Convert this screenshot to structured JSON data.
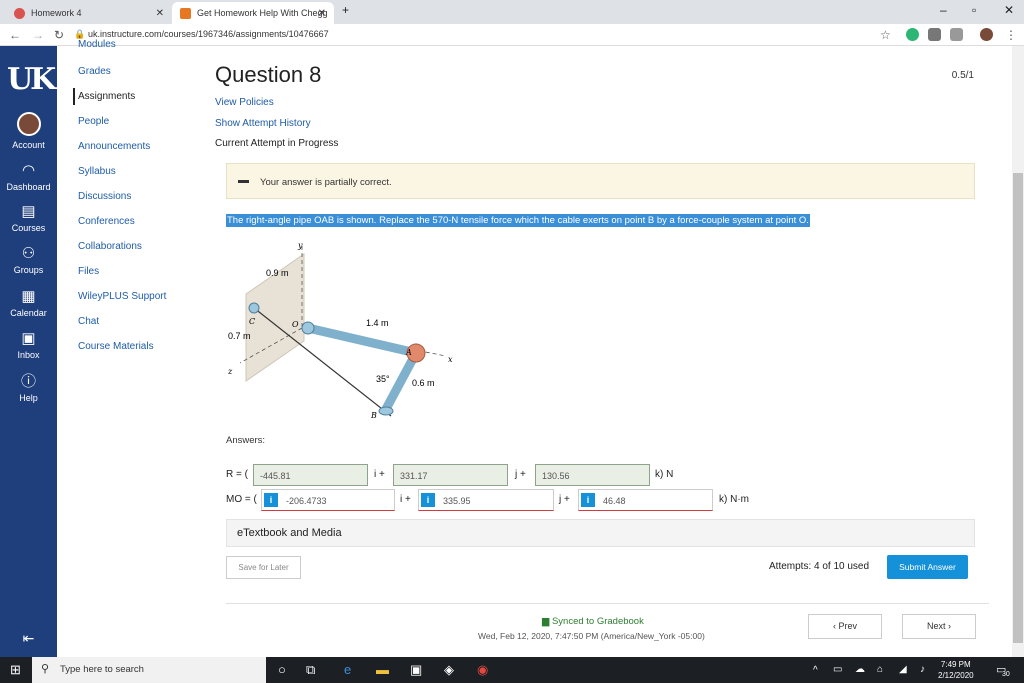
{
  "browser": {
    "tabs": [
      {
        "title": "Homework 4"
      },
      {
        "title": "Get Homework Help With Chegg"
      }
    ],
    "url": "uk.instructure.com/courses/1967346/assignments/10476667",
    "new_tab": "+"
  },
  "global_nav": {
    "logo": "UK",
    "items": [
      {
        "label": "Account",
        "icon": "avatar"
      },
      {
        "label": "Dashboard",
        "icon": "dashboard-icon"
      },
      {
        "label": "Courses",
        "icon": "book-icon"
      },
      {
        "label": "Groups",
        "icon": "groups-icon"
      },
      {
        "label": "Calendar",
        "icon": "calendar-icon"
      },
      {
        "label": "Inbox",
        "icon": "inbox-icon"
      },
      {
        "label": "Help",
        "icon": "help-icon"
      }
    ]
  },
  "course_nav": {
    "items": [
      {
        "label": "Modules"
      },
      {
        "label": "Grades"
      },
      {
        "label": "Assignments"
      },
      {
        "label": "People"
      },
      {
        "label": "Announcements"
      },
      {
        "label": "Syllabus"
      },
      {
        "label": "Discussions"
      },
      {
        "label": "Conferences"
      },
      {
        "label": "Collaborations"
      },
      {
        "label": "Files"
      },
      {
        "label": "WileyPLUS Support"
      },
      {
        "label": "Chat"
      },
      {
        "label": "Course Materials"
      }
    ]
  },
  "question": {
    "title": "Question 8",
    "score": "0.5/1",
    "view_policies": "View Policies",
    "show_history": "Show Attempt History",
    "status": "Current Attempt in Progress",
    "alert": "Your answer is partially correct.",
    "text": "The right-angle pipe OAB is shown. Replace the 570-N tensile force which the cable exerts on point B by a force-couple system at point O.",
    "figure_labels": {
      "y": "y",
      "x": "x",
      "z": "z",
      "c": "C",
      "o": "O",
      "a": "A",
      "b": "B",
      "d1": "0.9 m",
      "d2": "1.4 m",
      "d3": "0.7 m",
      "d4": "0.6 m",
      "angle": "35°"
    }
  },
  "answers": {
    "label": "Answers:",
    "r_label": "R = (",
    "r_values": [
      "-445.81",
      "331.17",
      "130.56"
    ],
    "r_unit": "k) N",
    "m_label": "MO = (",
    "m_values": [
      "-206.4733",
      "335.95",
      "46.48"
    ],
    "m_unit": "k) N·m",
    "i_sep": "i +",
    "j_sep": "j +",
    "info": "i"
  },
  "etextbook": "eTextbook and Media",
  "save_later": "Save for Later",
  "attempts": "Attempts: 4 of 10 used",
  "submit": "Submit Answer",
  "footer": {
    "synced": "Synced to Gradebook",
    "date": "Wed, Feb 12, 2020, 7:47:50 PM (America/New_York -05:00)",
    "prev": "‹ Prev",
    "next": "Next ›"
  },
  "taskbar": {
    "search": "Type here to search",
    "time": "7:49 PM",
    "date": "2/12/2020",
    "badge": "30"
  }
}
